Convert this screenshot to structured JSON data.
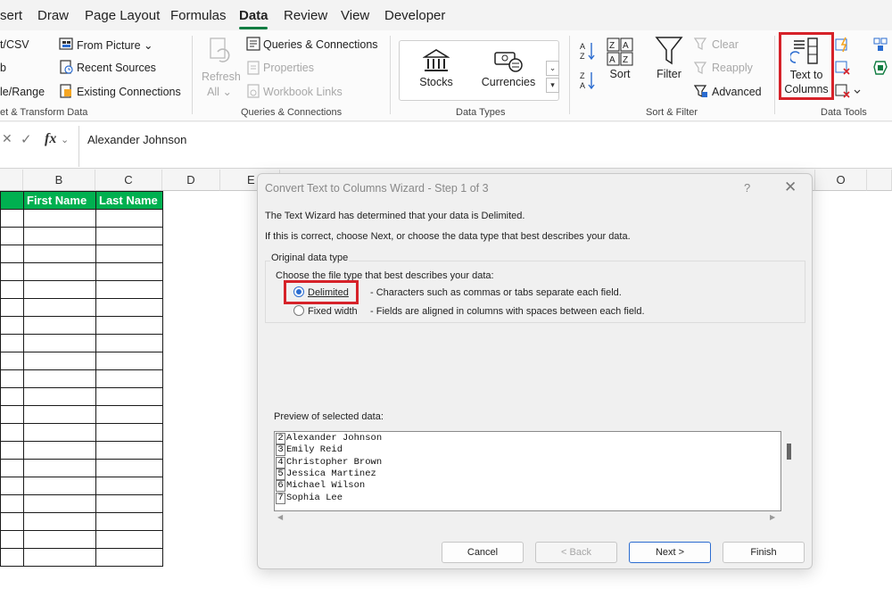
{
  "menu": {
    "tabs": [
      "sert",
      "Draw",
      "Page Layout",
      "Formulas",
      "Data",
      "Review",
      "View",
      "Developer"
    ],
    "active": "Data"
  },
  "ribbon": {
    "get_transform": {
      "items": [
        "t/CSV",
        "b",
        "le/Range"
      ],
      "from_picture": "From Picture",
      "recent_sources": "Recent Sources",
      "existing_connections": "Existing Connections",
      "label": "et & Transform Data"
    },
    "queries": {
      "refresh": "Refresh",
      "all": "All",
      "queries_connections": "Queries & Connections",
      "properties": "Properties",
      "workbook_links": "Workbook Links",
      "label": "Queries & Connections"
    },
    "data_types": {
      "stocks": "Stocks",
      "currencies": "Currencies",
      "label": "Data Types"
    },
    "sort_filter": {
      "sort": "Sort",
      "filter": "Filter",
      "clear": "Clear",
      "reapply": "Reapply",
      "advanced": "Advanced",
      "label": "Sort & Filter"
    },
    "data_tools": {
      "text_to": "Text to",
      "columns": "Columns",
      "label": "Data Tools"
    }
  },
  "formula_bar": {
    "fx": "fx",
    "value": "Alexander Johnson"
  },
  "sheet": {
    "columns": [
      "B",
      "C",
      "D",
      "E",
      "O"
    ],
    "headers": [
      "First Name",
      "Last Name"
    ],
    "row_count": 20
  },
  "dialog": {
    "title": "Convert Text to Columns Wizard - Step 1 of 3",
    "help": "?",
    "close": "✕",
    "line1": "The Text Wizard has determined that your data is Delimited.",
    "line2": "If this is correct, choose Next, or choose the data type that best describes your data.",
    "group_label": "Original data type",
    "choose_label": "Choose the file type that best describes your data:",
    "options": [
      {
        "label": "Delimited",
        "desc": "- Characters such as commas or tabs separate each field.",
        "selected": true
      },
      {
        "label": "Fixed width",
        "desc": "- Fields are aligned in columns with spaces between each field.",
        "selected": false
      }
    ],
    "preview_label": "Preview of selected data:",
    "preview_rows": [
      {
        "num": "2",
        "text": "Alexander Johnson"
      },
      {
        "num": "3",
        "text": "Emily Reid"
      },
      {
        "num": "4",
        "text": "Christopher Brown"
      },
      {
        "num": "5",
        "text": "Jessica Martinez"
      },
      {
        "num": "6",
        "text": "Michael Wilson"
      },
      {
        "num": "7",
        "text": "Sophia Lee"
      }
    ],
    "buttons": {
      "cancel": "Cancel",
      "back": "< Back",
      "next": "Next >",
      "finish": "Finish"
    }
  },
  "colors": {
    "excel_green": "#107c41",
    "header_green": "#00b050",
    "highlight_red": "#d62229",
    "radio_blue": "#2b6cd0"
  }
}
